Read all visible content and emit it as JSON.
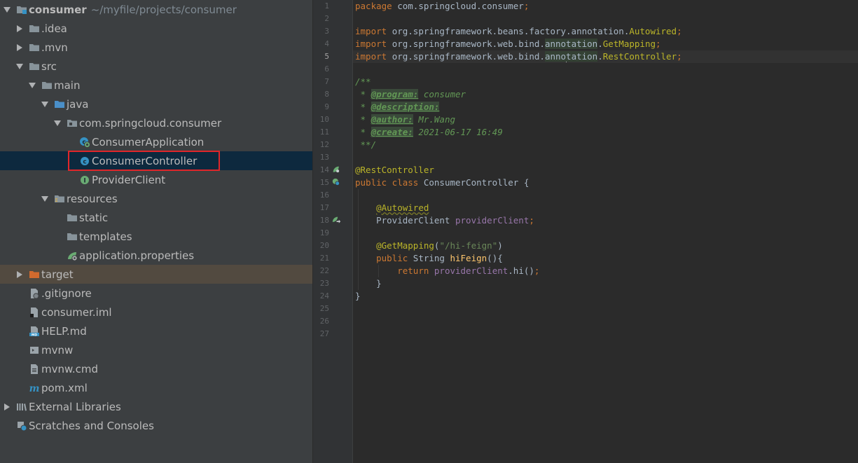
{
  "project": {
    "root_name": "consumer",
    "root_path": "~/myfile/projects/consumer",
    "items": [
      {
        "label": ".idea",
        "level": 1,
        "state": "collapsed",
        "icon": "folder-icon"
      },
      {
        "label": ".mvn",
        "level": 1,
        "state": "collapsed",
        "icon": "folder-icon"
      },
      {
        "label": "src",
        "level": 1,
        "state": "expanded",
        "icon": "folder-icon"
      },
      {
        "label": "main",
        "level": 2,
        "state": "expanded",
        "icon": "folder-icon"
      },
      {
        "label": "java",
        "level": 3,
        "state": "expanded",
        "icon": "source-folder-icon"
      },
      {
        "label": "com.springcloud.consumer",
        "level": 4,
        "state": "expanded",
        "icon": "package-icon"
      },
      {
        "label": "ConsumerApplication",
        "level": 5,
        "state": "none",
        "icon": "spring-boot-class-icon"
      },
      {
        "label": "ConsumerController",
        "level": 5,
        "state": "none",
        "icon": "class-icon",
        "selected": true
      },
      {
        "label": "ProviderClient",
        "level": 5,
        "state": "none",
        "icon": "interface-icon"
      },
      {
        "label": "resources",
        "level": 3,
        "state": "expanded",
        "icon": "resources-folder-icon"
      },
      {
        "label": "static",
        "level": 4,
        "state": "none",
        "icon": "folder-icon"
      },
      {
        "label": "templates",
        "level": 4,
        "state": "none",
        "icon": "folder-icon"
      },
      {
        "label": "application.properties",
        "level": 4,
        "state": "none",
        "icon": "spring-properties-icon"
      },
      {
        "label": "target",
        "level": 1,
        "state": "collapsed",
        "icon": "excluded-folder-icon",
        "excluded": true
      },
      {
        "label": ".gitignore",
        "level": 1,
        "state": "none",
        "icon": "gitignore-file-icon"
      },
      {
        "label": "consumer.iml",
        "level": 1,
        "state": "none",
        "icon": "iml-file-icon"
      },
      {
        "label": "HELP.md",
        "level": 1,
        "state": "none",
        "icon": "markdown-file-icon"
      },
      {
        "label": "mvnw",
        "level": 1,
        "state": "none",
        "icon": "shell-file-icon"
      },
      {
        "label": "mvnw.cmd",
        "level": 1,
        "state": "none",
        "icon": "text-file-icon"
      },
      {
        "label": "pom.xml",
        "level": 1,
        "state": "none",
        "icon": "maven-icon"
      },
      {
        "label": "External Libraries",
        "level": 0,
        "state": "collapsed",
        "icon": "libraries-icon"
      },
      {
        "label": "Scratches and Consoles",
        "level": 0,
        "state": "none",
        "icon": "scratches-icon"
      }
    ]
  },
  "editor": {
    "current_line": 5,
    "lines": [
      {
        "n": "1",
        "t": [
          [
            "kw",
            "package "
          ],
          [
            "",
            "com.springcloud.consumer"
          ],
          [
            "kw",
            ";"
          ]
        ]
      },
      {
        "n": "2",
        "t": []
      },
      {
        "n": "3",
        "t": [
          [
            "kw",
            "import "
          ],
          [
            "",
            "org.springframework.beans.factory.annotation."
          ],
          [
            "ann",
            "Autowired"
          ],
          [
            "kw",
            ";"
          ]
        ]
      },
      {
        "n": "4",
        "t": [
          [
            "kw",
            "import "
          ],
          [
            "",
            "org.springframework.web.bind."
          ],
          [
            "hl",
            "annotation"
          ],
          [
            "",
            "."
          ],
          [
            "ann",
            "GetMapping"
          ],
          [
            "kw",
            ";"
          ]
        ]
      },
      {
        "n": "5",
        "t": [
          [
            "kw",
            "import "
          ],
          [
            "",
            "org.springframework.web.bind."
          ],
          [
            "hl",
            "anno"
          ],
          [
            "caret",
            ""
          ],
          [
            "hl",
            "tation"
          ],
          [
            "",
            "."
          ],
          [
            "ann",
            "RestController"
          ],
          [
            "kw",
            ";"
          ]
        ]
      },
      {
        "n": "6",
        "t": []
      },
      {
        "n": "7",
        "t": [
          [
            "doc",
            "/**"
          ]
        ]
      },
      {
        "n": "8",
        "t": [
          [
            "doc",
            " * "
          ],
          [
            "doctag",
            "@program:"
          ],
          [
            "doc",
            " consumer"
          ]
        ]
      },
      {
        "n": "9",
        "t": [
          [
            "doc",
            " * "
          ],
          [
            "doctag",
            "@description:"
          ]
        ]
      },
      {
        "n": "10",
        "t": [
          [
            "doc",
            " * "
          ],
          [
            "doctag",
            "@author:"
          ],
          [
            "doc",
            " Mr.Wang"
          ]
        ]
      },
      {
        "n": "11",
        "t": [
          [
            "doc",
            " * "
          ],
          [
            "doctag",
            "@create:"
          ],
          [
            "doc",
            " 2021-06-17 16:49"
          ]
        ]
      },
      {
        "n": "12",
        "t": [
          [
            "doc",
            " **/"
          ]
        ]
      },
      {
        "n": "13",
        "t": []
      },
      {
        "n": "14",
        "t": [
          [
            "ann",
            "@RestController"
          ]
        ]
      },
      {
        "n": "15",
        "t": [
          [
            "kw",
            "public class "
          ],
          [
            "",
            "ConsumerController {"
          ]
        ]
      },
      {
        "n": "16",
        "t": []
      },
      {
        "n": "17",
        "t": [
          [
            "",
            "    "
          ],
          [
            "annsq",
            "@Autowired"
          ]
        ]
      },
      {
        "n": "18",
        "t": [
          [
            "",
            "    ProviderClient "
          ],
          [
            "fld",
            "providerClient"
          ],
          [
            "kw",
            ";"
          ]
        ]
      },
      {
        "n": "19",
        "t": []
      },
      {
        "n": "20",
        "t": [
          [
            "",
            "    "
          ],
          [
            "ann",
            "@GetMapping"
          ],
          [
            "",
            "("
          ],
          [
            "str",
            "\"/hi-feign\""
          ],
          [
            "",
            ")"
          ]
        ]
      },
      {
        "n": "21",
        "t": [
          [
            "",
            "    "
          ],
          [
            "kw",
            "public "
          ],
          [
            "",
            "String "
          ],
          [
            "fn",
            "hiFeign"
          ],
          [
            "",
            "(){"
          ]
        ]
      },
      {
        "n": "22",
        "t": [
          [
            "",
            "        "
          ],
          [
            "kw",
            "return "
          ],
          [
            "fld",
            "providerClient"
          ],
          [
            "",
            ".hi()"
          ],
          [
            "kw",
            ";"
          ]
        ]
      },
      {
        "n": "23",
        "t": [
          [
            "",
            "    }"
          ]
        ]
      },
      {
        "n": "24",
        "t": [
          [
            "",
            "}"
          ]
        ]
      },
      {
        "n": "25",
        "t": []
      },
      {
        "n": "26",
        "t": []
      },
      {
        "n": "27",
        "t": []
      }
    ],
    "gutter_icons": [
      {
        "line": 14,
        "icon": "spring-bean-icon"
      },
      {
        "line": 15,
        "icon": "spring-class-icon"
      },
      {
        "line": 18,
        "icon": "autowired-navigate-icon"
      }
    ]
  },
  "colors": {
    "tree_bg": "#3c3f41",
    "selection_bg": "#0d293e",
    "excluded_bg": "#524a40",
    "highlight_border": "#e0262a",
    "editor_bg": "#2b2b2b"
  }
}
